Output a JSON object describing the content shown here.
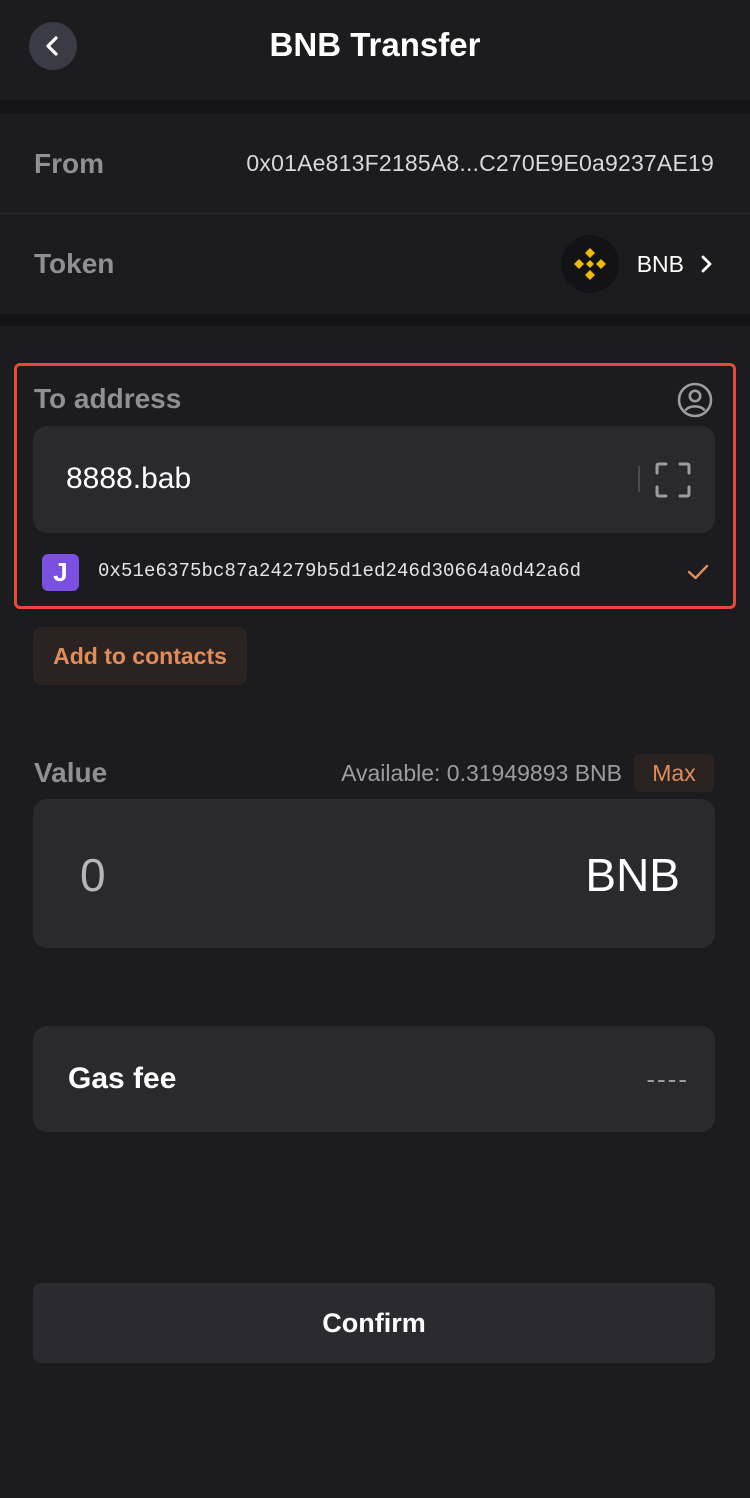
{
  "header": {
    "title": "BNB Transfer"
  },
  "from": {
    "label": "From",
    "address": "0x01Ae813F2185A8...C270E9E0a9237AE19"
  },
  "token": {
    "label": "Token",
    "name": "BNB"
  },
  "to": {
    "label": "To address",
    "input_value": "8888.bab",
    "resolved_address": "0x51e6375bc87a24279b5d1ed246d30664a0d42a6d",
    "resolved_badge": "J",
    "add_contacts_label": "Add to contacts"
  },
  "value": {
    "label": "Value",
    "available": "Available: 0.31949893 BNB",
    "max_label": "Max",
    "amount": "0",
    "unit": "BNB"
  },
  "gas": {
    "label": "Gas fee",
    "value": "----"
  },
  "confirm_label": "Confirm",
  "colors": {
    "background": "#1c1c1e",
    "field": "#2a2a2e",
    "accent": "#e08d5c",
    "highlight_border": "#e64a3b",
    "bnb_gold": "#f0b90b",
    "badge_purple": "#7b4fe0"
  }
}
